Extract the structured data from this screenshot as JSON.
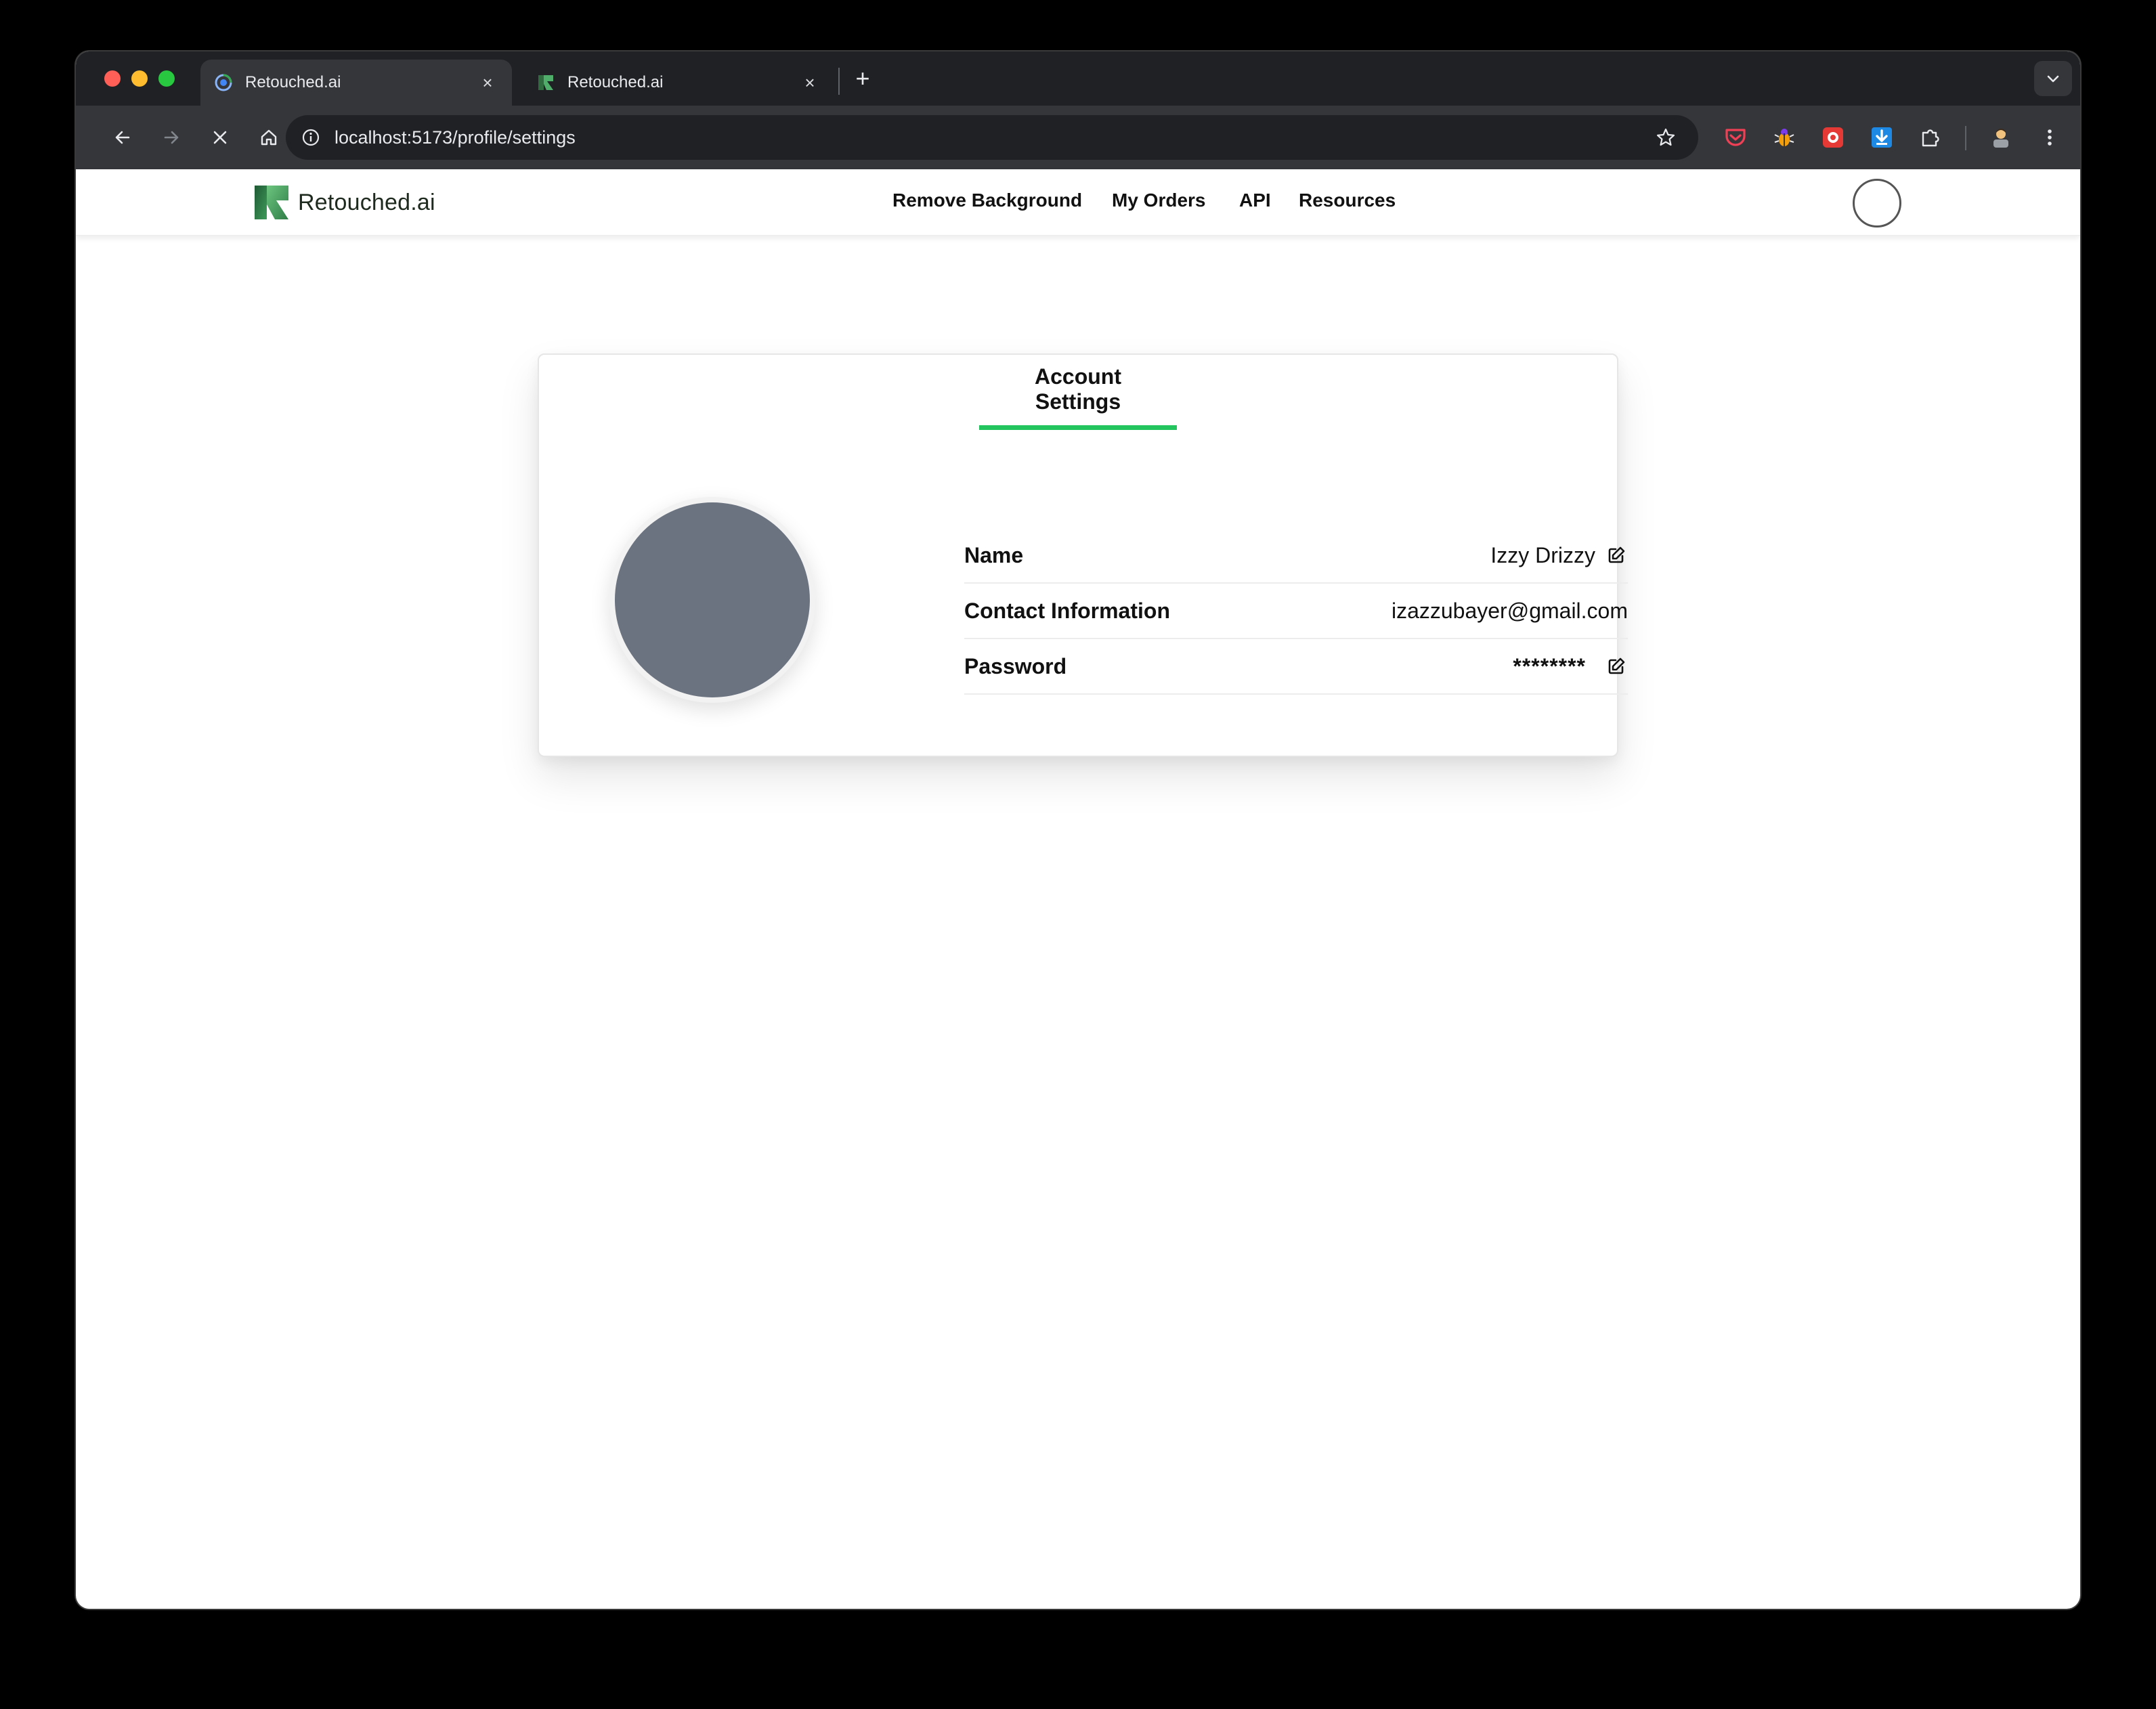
{
  "browser": {
    "tabs": [
      {
        "title": "Retouched.ai",
        "active": true
      },
      {
        "title": "Retouched.ai",
        "active": false
      }
    ],
    "new_tab_symbol": "+",
    "close_symbol": "×",
    "url": "localhost:5173/profile/settings",
    "icons": {
      "back": "arrow-left-icon",
      "forward": "arrow-right-icon",
      "stop": "close-icon",
      "home": "home-icon",
      "info": "info-icon",
      "bookmark": "star-icon",
      "menu": "kebab-menu-icon"
    }
  },
  "site": {
    "logo_text": "Retouched.ai",
    "nav": [
      "Remove Background",
      "My Orders",
      "API",
      "Resources"
    ]
  },
  "settings": {
    "tab_label": "Account Settings",
    "fields": [
      {
        "label": "Name",
        "value": "Izzy Drizzy",
        "editable": true
      },
      {
        "label": "Contact Information",
        "value": "izazzubayer@gmail.com",
        "editable": false
      },
      {
        "label": "Password",
        "value": "********",
        "editable": true
      }
    ]
  },
  "colors": {
    "accent": "#22c55e",
    "avatar": "#6b7280",
    "chrome_dark": "#202124",
    "chrome_tab": "#35363a"
  }
}
